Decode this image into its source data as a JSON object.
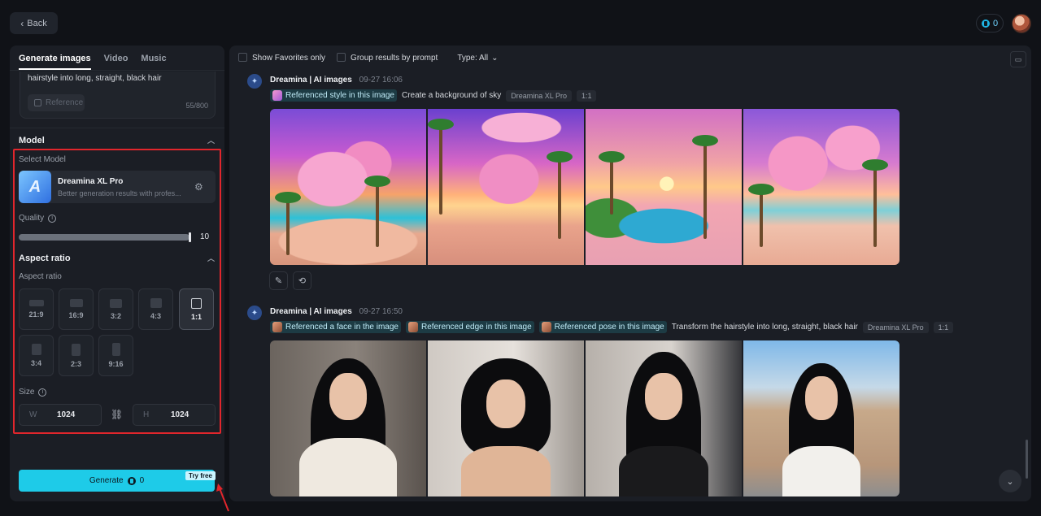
{
  "header": {
    "back_label": "Back",
    "credits": "0"
  },
  "tabs": [
    "Generate images",
    "Video",
    "Music"
  ],
  "prompt": {
    "text": "hairstyle into long, straight, black hair",
    "reference_label": "Reference",
    "char_count": "55/800"
  },
  "model_section": {
    "title": "Model",
    "select_label": "Select Model",
    "model_name": "Dreamina XL Pro",
    "model_desc": "Better generation results with profes...",
    "quality_label": "Quality",
    "quality_value": "10"
  },
  "aspect_section": {
    "title": "Aspect ratio",
    "label": "Aspect ratio",
    "ratios": [
      "21:9",
      "16:9",
      "3:2",
      "4:3",
      "1:1",
      "3:4",
      "2:3",
      "9:16"
    ],
    "selected": "1:1"
  },
  "size": {
    "label": "Size",
    "w_label": "W",
    "w_value": "1024",
    "h_label": "H",
    "h_value": "1024"
  },
  "generate": {
    "label": "Generate",
    "credits": "0",
    "badge": "Try free"
  },
  "filters": {
    "favorites": "Show Favorites only",
    "group": "Group results by prompt",
    "type": "Type: All"
  },
  "generations": [
    {
      "source": "Dreamina | AI images",
      "time": "09-27  16:06",
      "refs": [
        "Referenced style in this image"
      ],
      "prompt": "Create a background of sky",
      "model_tag": "Dreamina XL Pro",
      "ratio_tag": "1:1"
    },
    {
      "source": "Dreamina | AI images",
      "time": "09-27  16:50",
      "refs": [
        "Referenced a face in the image",
        "Referenced edge in this image",
        "Referenced pose in this image"
      ],
      "prompt": "Transform the hairstyle into long, straight, black hair",
      "model_tag": "Dreamina XL Pro",
      "ratio_tag": "1:1"
    }
  ],
  "colors": {
    "accent": "#1ecbe8",
    "highlight_frame": "#e1262c",
    "background": "#101217",
    "panel": "#1b1e25"
  }
}
